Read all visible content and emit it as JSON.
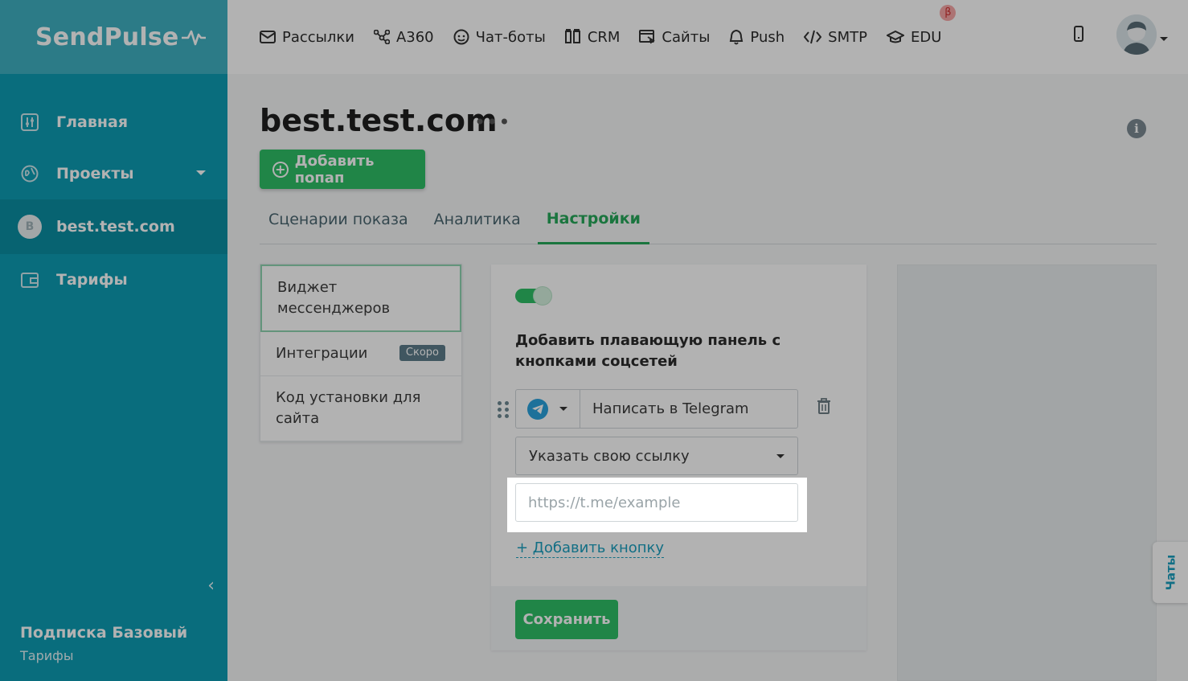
{
  "brand": {
    "logo_text": "SendPulse"
  },
  "sidebar": {
    "items": [
      {
        "label": "Главная",
        "icon": "dashboard-icon"
      },
      {
        "label": "Проекты",
        "icon": "globe-icon"
      },
      {
        "label": "best.test.com",
        "avatar_letter": "B"
      },
      {
        "label": "Тарифы",
        "icon": "wallet-icon"
      }
    ],
    "subscription_title": "Подписка Базовый",
    "subscription_link": "Тарифы"
  },
  "topnav": {
    "items": [
      {
        "label": "Рассылки",
        "icon": "envelope-icon"
      },
      {
        "label": "A360",
        "icon": "nodes-icon"
      },
      {
        "label": "Чат-боты",
        "icon": "chatbot-icon"
      },
      {
        "label": "CRM",
        "icon": "crm-icon"
      },
      {
        "label": "Сайты",
        "icon": "site-icon"
      },
      {
        "label": "Push",
        "icon": "bell-icon"
      },
      {
        "label": "SMTP",
        "icon": "code-icon"
      },
      {
        "label": "EDU",
        "icon": "graduation-cap-icon",
        "badge": "β"
      }
    ]
  },
  "page": {
    "title": "best.test.com",
    "add_popup_label": "Добавить попап",
    "tabs": [
      {
        "label": "Сценарии показа"
      },
      {
        "label": "Аналитика"
      },
      {
        "label": "Настройки",
        "active": true
      }
    ]
  },
  "settings_menu": {
    "items": [
      {
        "label": "Виджет мессенджеров"
      },
      {
        "label": "Интеграции",
        "badge": "Скоро"
      },
      {
        "label": "Код установки для сайта"
      }
    ]
  },
  "widget": {
    "heading": "Добавить плавающую панель с кнопками соцсетей",
    "button_text": "Написать в Telegram",
    "link_select_value": "Указать свою ссылку",
    "url_placeholder": "https://t.me/example",
    "add_button_label": "+ Добавить кнопку",
    "save_label": "Сохранить"
  },
  "chats_tab_label": "Чаты",
  "colors": {
    "primary_green": "#2fbf66",
    "sidebar_teal": "#0d9cb3",
    "link_blue": "#1a9fbf"
  }
}
